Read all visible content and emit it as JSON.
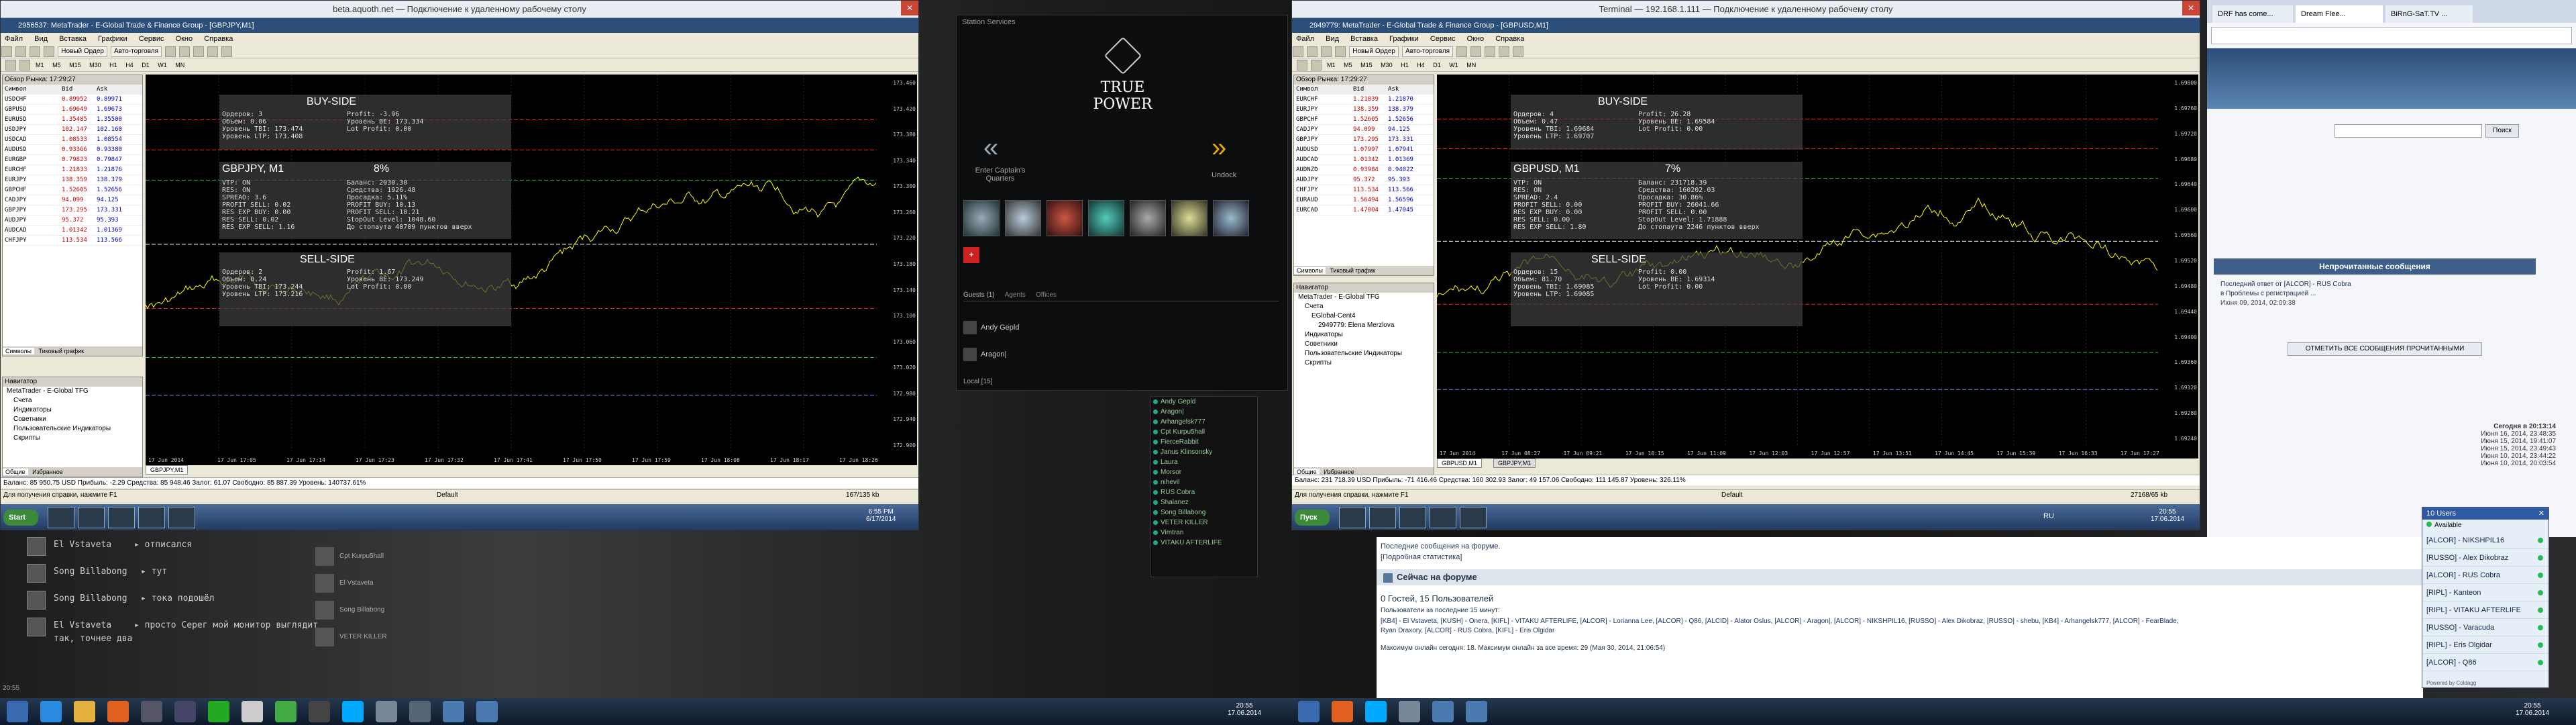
{
  "left_window": {
    "rd_title": "beta.aquoth.net — Подключение к удаленному рабочему столу",
    "title": "2956537: MetaTrader - E-Global Trade & Finance Group - [GBPJPY,M1]",
    "menu": [
      "Файл",
      "Вид",
      "Вставка",
      "Графики",
      "Сервис",
      "Окно",
      "Справка"
    ],
    "btn_new_order": "Новый Ордер",
    "btn_autotrade": "Авто-торговля",
    "timeframes": [
      "M1",
      "M5",
      "M15",
      "M30",
      "H1",
      "H4",
      "D1",
      "W1",
      "MN"
    ],
    "mw_header": "Обзор Рынка: 17:29:27",
    "mw_cols": [
      "Символ",
      "Bid",
      "Ask"
    ],
    "mw_rows": [
      [
        "USDCHF",
        "0.89952",
        "0.89971"
      ],
      [
        "GBPUSD",
        "1.69649",
        "1.69673"
      ],
      [
        "EURUSD",
        "1.35485",
        "1.35500"
      ],
      [
        "USDJPY",
        "102.147",
        "102.160"
      ],
      [
        "USDCAD",
        "1.08533",
        "1.08554"
      ],
      [
        "AUDUSD",
        "0.93366",
        "0.93380"
      ],
      [
        "EURGBP",
        "0.79823",
        "0.79847"
      ],
      [
        "EURCHF",
        "1.21833",
        "1.21876"
      ],
      [
        "EURJPY",
        "138.359",
        "138.379"
      ],
      [
        "GBPCHF",
        "1.52605",
        "1.52656"
      ],
      [
        "CADJPY",
        "94.099",
        "94.125"
      ],
      [
        "GBPJPY",
        "173.295",
        "173.331"
      ],
      [
        "AUDJPY",
        "95.372",
        "95.393"
      ],
      [
        "AUDCAD",
        "1.01342",
        "1.01369"
      ],
      [
        "CHFJPY",
        "113.534",
        "113.566"
      ]
    ],
    "mw_tabs": [
      "Символы",
      "Тиковый график"
    ],
    "nav_items": [
      "MetaTrader - E-Global TFG",
      "Счета",
      "Индикаторы",
      "Советники",
      "Пользовательские Индикаторы",
      "Скрипты"
    ],
    "nav_tabs": [
      "Общие",
      "Избранное"
    ],
    "chart_symbol": "GBPJPY, M1",
    "chart_pct": "8%",
    "buy_side": "BUY-SIDE",
    "sell_side": "SELL-SIDE",
    "buy_lines": [
      "Ордеров: 3",
      "Объем: 0.06",
      "Уровень TBI: 173.474",
      "Уровень LTP: 173.408"
    ],
    "buy_right": [
      "Profit: -3.96",
      "Уровень BE: 173.334",
      "Lot Profit: 0.00"
    ],
    "mid_lines": [
      "VTP: ON",
      "RES: ON",
      "SPREAD: 3.6",
      "PROFIT SELL: 0.02",
      "RES EXP BUY: 0.00",
      "RES SELL: 0.02",
      "RES EXP SELL: 1.16"
    ],
    "mid_right": [
      "Баланс: 2030.30",
      "Средства: 1926.48",
      "Просадка: 5.11%",
      "PROFIT BUY: 10.13",
      "PROFIT SELL: 10.21",
      "StopOut Level: 1048.60",
      "До стопаута 40709 пунктов вверх"
    ],
    "sell_lines": [
      "Ордеров: 2",
      "Объем: 0.24",
      "Уровень TBI: 173.244",
      "Уровень LTP: 173.216"
    ],
    "sell_right": [
      "Profit: 1.67",
      "Уровень BE: 173.249",
      "Lot Profit: 0.00"
    ],
    "price_ticks": [
      "173.460",
      "173.420",
      "173.380",
      "173.340",
      "173.300",
      "173.260",
      "173.220",
      "173.180",
      "173.140",
      "173.100",
      "173.060",
      "173.020",
      "172.980",
      "172.940",
      "172.900"
    ],
    "time_ticks": [
      "17 Jun 2014",
      "17 Jun 17:05",
      "17 Jun 17:14",
      "17 Jun 17:23",
      "17 Jun 17:32",
      "17 Jun 17:41",
      "17 Jun 17:50",
      "17 Jun 17:59",
      "17 Jun 18:08",
      "17 Jun 18:17",
      "17 Jun 18:26"
    ],
    "chart_tab": "GBPJPY,M1",
    "balance_line": "Баланс: 85 950.75 USD Прибыль: -2.29 Средства: 85 948.46 Залог: 61.07 Свободно: 85 887.39 Уровень: 140737.61%",
    "status_left": "Для получения справки, нажмите F1",
    "status_default": "Default",
    "status_kb": "167/135 kb"
  },
  "game_bg": {
    "panel_title": "Station Services",
    "brand_line1": "TRUE",
    "brand_line2": "POWER",
    "left_label": "Enter Captain's Quarters",
    "right_label": "Undock",
    "chat_tabs": [
      "Guests (1)",
      "Agents",
      "Offices"
    ],
    "chat_lines": [
      {
        "name": "El Vstaveta",
        "text": "▸ отписался"
      },
      {
        "name": "Song Billabong",
        "text": "▸ тут"
      },
      {
        "name": "Song Billabong",
        "text": "▸ тока подошёл"
      },
      {
        "name": "El Vstaveta",
        "text": "▸ просто Серег мой монитор выглядит"
      },
      {
        "name": "",
        "text": "так, точнее два"
      }
    ],
    "portraits": [
      "Cpt Kurpu5hall",
      "El Vstaveta",
      "Song Billabong",
      "VETER KILLER"
    ],
    "local_users": [
      "Andy Gepld",
      "Aragon|",
      "Arhangelsk777",
      "Cpt Kurpu5hall",
      "FierceRabbit",
      "Janus Klinsonsky",
      "Laura",
      "Morsor",
      "nihevil",
      "RUS Cobra",
      "Shalanez",
      "Song Billabong",
      "VETER KILLER",
      "Vimtran",
      "VITAKU AFTERLIFE"
    ],
    "mini_names": [
      "Andy Gepld",
      "Aragon|"
    ],
    "local_label": "Local [15]",
    "clock_small": "20:55"
  },
  "right_window": {
    "rd_title": "Terminal — 192.168.1.111 — Подключение к удаленному рабочему столу",
    "title": "2949779: MetaTrader - E-Global Trade & Finance Group - [GBPUSD,M1]",
    "menu": [
      "Файл",
      "Вид",
      "Вставка",
      "Графики",
      "Сервис",
      "Окно",
      "Справка"
    ],
    "btn_new_order": "Новый Ордер",
    "btn_autotrade": "Авто-торговля",
    "timeframes": [
      "M1",
      "M5",
      "M15",
      "M30",
      "H1",
      "H4",
      "D1",
      "W1",
      "MN"
    ],
    "mw_header": "Обзор Рынка: 17:29:27",
    "mw_cols": [
      "Символ",
      "Bid",
      "Ask"
    ],
    "mw_rows": [
      [
        "EURCHF",
        "1.21839",
        "1.21870"
      ],
      [
        "EURJPY",
        "138.359",
        "138.379"
      ],
      [
        "GBPCHF",
        "1.52605",
        "1.52656"
      ],
      [
        "CADJPY",
        "94.099",
        "94.125"
      ],
      [
        "GBPJPY",
        "173.295",
        "173.331"
      ],
      [
        "AUDUSD",
        "1.07997",
        "1.07941"
      ],
      [
        "AUDCAD",
        "1.01342",
        "1.01369"
      ],
      [
        "AUDNZD",
        "0.93984",
        "0.94022"
      ],
      [
        "AUDJPY",
        "95.372",
        "95.393"
      ],
      [
        "CHFJPY",
        "113.534",
        "113.566"
      ],
      [
        "EURAUD",
        "1.56494",
        "1.56596"
      ],
      [
        "EURCAD",
        "1.47004",
        "1.47045"
      ]
    ],
    "mw_tabs": [
      "Символы",
      "Тиковый график"
    ],
    "nav_items": [
      "MetaTrader - E-Global TFG",
      "Счета",
      "EGlobal-Cent4",
      "2949779: Elena Merzlova",
      "Индикаторы",
      "Советники",
      "Пользовательские Индикаторы",
      "Скрипты"
    ],
    "nav_tabs": [
      "Общие",
      "Избранное"
    ],
    "chart_symbol": "GBPUSD, M1",
    "chart_pct": "7%",
    "buy_side": "BUY-SIDE",
    "sell_side": "SELL-SIDE",
    "buy_lines": [
      "Ордеров: 4",
      "Объем: 0.47",
      "Уровень TBI: 1.69684",
      "Уровень LTP: 1.69707"
    ],
    "buy_right": [
      "Profit: 26.28",
      "Уровень BE: 1.69584",
      "Lot Profit: 0.00"
    ],
    "mid_lines": [
      "VTP: ON",
      "RES: ON",
      "SPREAD: 2.4",
      "PROFIT SELL: 0.00",
      "RES EXP BUY: 0.00",
      "RES SELL: 0.00",
      "RES EXP SELL: 1.80"
    ],
    "mid_right": [
      "Баланс: 231718.39",
      "Средства: 160202.03",
      "Просадка: 30.86%",
      "PROFIT BUY: 26041.66",
      "PROFIT SELL: 0.00",
      "StopOut Level: 1.71888",
      "До стопаута 2246 пунктов вверх"
    ],
    "sell_lines": [
      "Ордеров: 15",
      "Объем: 81.70",
      "Уровень TBI: 1.69085",
      "Уровень LTP: 1.69085"
    ],
    "sell_right": [
      "Profit: 0.00",
      "Уровень BE: 1.69314",
      "Lot Profit: 0.00"
    ],
    "price_ticks": [
      "1.69800",
      "1.69760",
      "1.69720",
      "1.69680",
      "1.69640",
      "1.69600",
      "1.69560",
      "1.69520",
      "1.69480",
      "1.69440",
      "1.69400",
      "1.69360",
      "1.69320",
      "1.69280",
      "1.69240"
    ],
    "time_ticks": [
      "17 Jun 2014",
      "17 Jun 08:27",
      "17 Jun 09:21",
      "17 Jun 10:15",
      "17 Jun 11:09",
      "17 Jun 12:03",
      "17 Jun 12:57",
      "17 Jun 13:51",
      "17 Jun 14:45",
      "17 Jun 15:39",
      "17 Jun 16:33",
      "17 Jun 17:27"
    ],
    "chart_tabs": [
      "GBPUSD,M1",
      "GBPJPY,M1"
    ],
    "balance_line": "Баланс: 231 718.39 USD Прибыль: -71 416.46 Средства: 160 302.93 Залог: 49 157.06 Свободно: 111 145.87 Уровень: 326.11%",
    "status_left": "Для получения справки, нажмите F1",
    "status_default": "Default",
    "status_kb": "27168/65 kb"
  },
  "browser": {
    "tabs": [
      "DRF has come...",
      "Dream Flee...",
      "BiRnG-SaT.TV ..."
    ],
    "search_btn": "Поиск",
    "unread_header": "Непрочитанные сообщения",
    "last_reply": "Последний ответ от [ALCOR] - RUS Cobra",
    "last_reply2": "в Проблемы с регистрацией ...",
    "last_reply_date": "Июня 09, 2014, 02:09:38",
    "mark_read_btn": "ОТМЕТИТЬ ВСЕ СООБЩЕНИЯ ПРОЧИТАННЫМИ",
    "dates": [
      "Сегодня в 20:13:14",
      "Июня 16, 2014, 23:48:35",
      "Июня 15, 2014, 19:41:07",
      "Июня 15, 2014, 23:49:43",
      "Июня 10, 2014, 23:44:22",
      "Июня 10, 2014, 20:03:54"
    ],
    "last_posts_link": "Последние сообщения на форуме.",
    "stats_link": "[Подробная статистика]",
    "online_header": "Сейчас на форуме",
    "online_summary": "0 Гостей, 15 Пользователей",
    "online_note": "Пользователи за последние 15 минут:",
    "online_list": "[KB4] - El Vstaveta, [KUSH] - Onera, [KIFL] - VITAKU AFTERLIFE, [ALCOR] - Lorianna Lee, [ALCOR] - Q86, [ALCID] - Alator Oslus, [ALCOR] - Aragon|, [ALCOR] - NIKSHPIL16, [RUSSO] - Alex Dikobraz, [RUSSO] - shebu, [KB4] - Arhangelsk777, [ALCOR] - FearBlade,",
    "online_list2": "Ryan Draxory, [ALCOR] - RUS Cobra, [KIFL] - Eris Olgidar",
    "record_line": "Максимум онлайн сегодня: 18. Максимум онлайн за все время: 29 (Мая 30, 2014, 21:06:54)"
  },
  "users_panel": {
    "title": "10 Users",
    "status": "Available",
    "users": [
      "[ALCOR] - NIKSHPIL16",
      "[RUSSO] - Alex Dikobraz",
      "[ALCOR] - RUS Cobra",
      "[RIPL] - Kanteon",
      "[RIPL] - VITAKU AFTERLIFE",
      "[RUSSO] - Varacuda",
      "[RIPL] - Eris Olgidar",
      "[ALCOR] - Q86"
    ],
    "footer": "Powered by Coldagg"
  },
  "taskbars": {
    "left_start": "Start",
    "left_time": "6:55 PM",
    "left_date": "6/17/2014",
    "right_start": "Пуск",
    "right_lang": "RU",
    "right_time": "20:55",
    "right_date": "17.06.2014",
    "main_time": "20:55",
    "main_date": "17.06.2014"
  },
  "colors": {
    "chart_bg": "#000000",
    "price_line": "#ffff00",
    "level_red": "#ff2020",
    "level_green": "#20c040",
    "taskbar": "#1a2b40",
    "forum_header": "#3d5f8a"
  }
}
